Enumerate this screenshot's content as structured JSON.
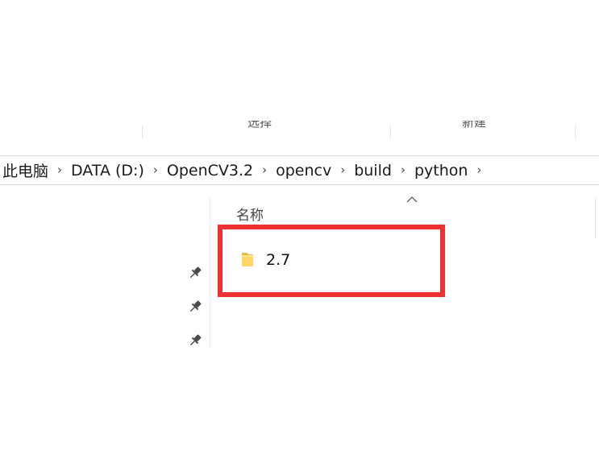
{
  "ribbon": {
    "groups": [
      {
        "label": "选择"
      },
      {
        "label": "新建"
      }
    ]
  },
  "breadcrumb": {
    "items": [
      "此电脑",
      "DATA (D:)",
      "OpenCV3.2",
      "opencv",
      "build",
      "python"
    ],
    "separator": "›"
  },
  "nav_pane": {
    "pinned_icons": [
      "pin-icon",
      "pin-icon",
      "pin-icon"
    ]
  },
  "content": {
    "column_header": "名称",
    "sort_indicator": "ascending",
    "files": [
      {
        "name": "2.7",
        "type": "folder",
        "icon": "folder-icon"
      }
    ]
  },
  "annotation": {
    "highlight_color": "#ee3232"
  }
}
